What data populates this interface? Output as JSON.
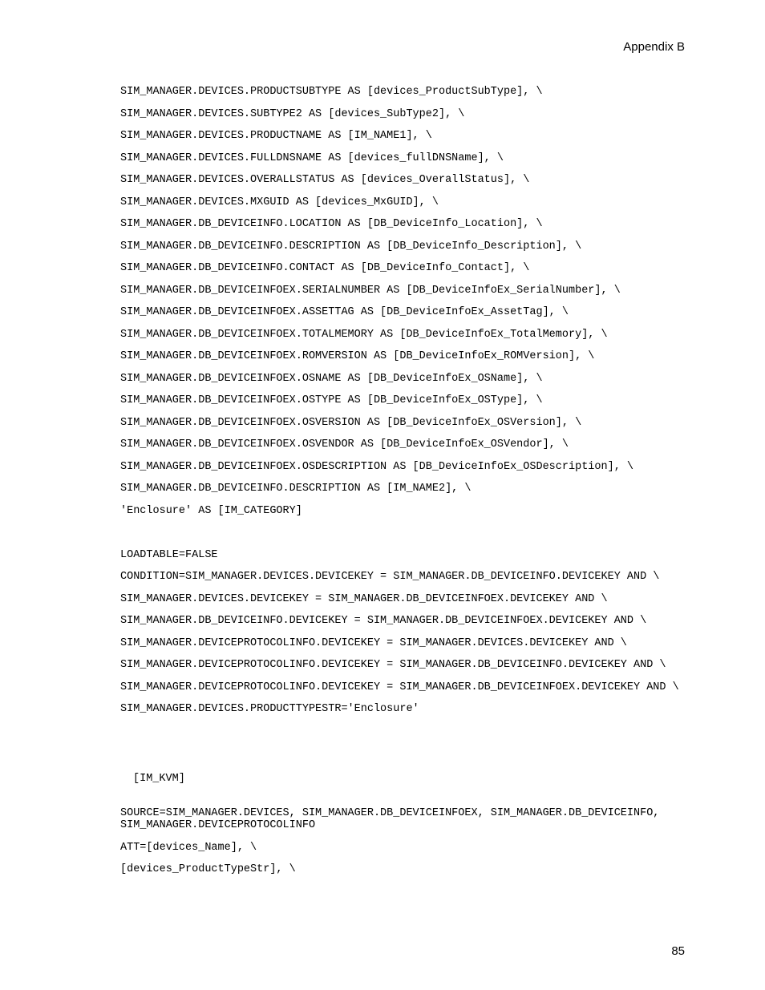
{
  "header": "Appendix B",
  "lines": [
    "SIM_MANAGER.DEVICES.PRODUCTSUBTYPE AS [devices_ProductSubType], \\",
    "SIM_MANAGER.DEVICES.SUBTYPE2 AS [devices_SubType2], \\",
    "SIM_MANAGER.DEVICES.PRODUCTNAME AS [IM_NAME1], \\",
    "SIM_MANAGER.DEVICES.FULLDNSNAME AS [devices_fullDNSName], \\",
    "SIM_MANAGER.DEVICES.OVERALLSTATUS AS [devices_OverallStatus], \\",
    "SIM_MANAGER.DEVICES.MXGUID AS [devices_MxGUID], \\",
    "SIM_MANAGER.DB_DEVICEINFO.LOCATION AS [DB_DeviceInfo_Location], \\",
    "SIM_MANAGER.DB_DEVICEINFO.DESCRIPTION AS [DB_DeviceInfo_Description], \\",
    "SIM_MANAGER.DB_DEVICEINFO.CONTACT AS [DB_DeviceInfo_Contact], \\",
    "SIM_MANAGER.DB_DEVICEINFOEX.SERIALNUMBER AS [DB_DeviceInfoEx_SerialNumber], \\",
    "SIM_MANAGER.DB_DEVICEINFOEX.ASSETTAG AS [DB_DeviceInfoEx_AssetTag], \\",
    "SIM_MANAGER.DB_DEVICEINFOEX.TOTALMEMORY AS [DB_DeviceInfoEx_TotalMemory], \\",
    "SIM_MANAGER.DB_DEVICEINFOEX.ROMVERSION AS [DB_DeviceInfoEx_ROMVersion], \\",
    "SIM_MANAGER.DB_DEVICEINFOEX.OSNAME AS [DB_DeviceInfoEx_OSName], \\",
    "SIM_MANAGER.DB_DEVICEINFOEX.OSTYPE AS [DB_DeviceInfoEx_OSType], \\",
    "SIM_MANAGER.DB_DEVICEINFOEX.OSVERSION AS [DB_DeviceInfoEx_OSVersion], \\",
    "SIM_MANAGER.DB_DEVICEINFOEX.OSVENDOR AS [DB_DeviceInfoEx_OSVendor], \\",
    "SIM_MANAGER.DB_DEVICEINFOEX.OSDESCRIPTION AS [DB_DeviceInfoEx_OSDescription], \\",
    "SIM_MANAGER.DB_DEVICEINFO.DESCRIPTION AS [IM_NAME2], \\",
    "'Enclosure' AS [IM_CATEGORY]",
    "",
    "LOADTABLE=FALSE",
    "CONDITION=SIM_MANAGER.DEVICES.DEVICEKEY = SIM_MANAGER.DB_DEVICEINFO.DEVICEKEY AND \\",
    "SIM_MANAGER.DEVICES.DEVICEKEY = SIM_MANAGER.DB_DEVICEINFOEX.DEVICEKEY AND \\",
    "SIM_MANAGER.DB_DEVICEINFO.DEVICEKEY = SIM_MANAGER.DB_DEVICEINFOEX.DEVICEKEY AND \\",
    "SIM_MANAGER.DEVICEPROTOCOLINFO.DEVICEKEY = SIM_MANAGER.DEVICES.DEVICEKEY AND \\",
    "SIM_MANAGER.DEVICEPROTOCOLINFO.DEVICEKEY = SIM_MANAGER.DB_DEVICEINFO.DEVICEKEY AND \\",
    "SIM_MANAGER.DEVICEPROTOCOLINFO.DEVICEKEY = SIM_MANAGER.DB_DEVICEINFOEX.DEVICEKEY AND \\",
    "SIM_MANAGER.DEVICES.PRODUCTTYPESTR='Enclosure'",
    ""
  ],
  "section_header": "[IM_KVM]",
  "lines2": [
    "SOURCE=SIM_MANAGER.DEVICES, SIM_MANAGER.DB_DEVICEINFOEX, SIM_MANAGER.DB_DEVICEINFO, SIM_MANAGER.DEVICEPROTOCOLINFO",
    "ATT=[devices_Name], \\",
    "[devices_ProductTypeStr], \\"
  ],
  "page_number": "85"
}
